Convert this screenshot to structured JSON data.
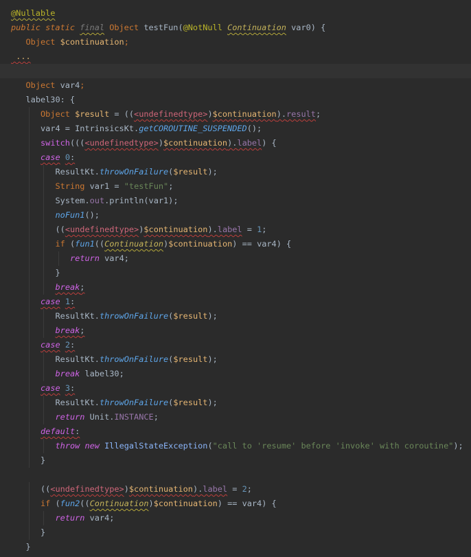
{
  "editor": {
    "lines": [
      {
        "indent": 0,
        "tokens": [
          {
            "t": "@Nullable",
            "c": "anno",
            "u": "ylw"
          }
        ]
      },
      {
        "indent": 0,
        "tokens": [
          {
            "t": "public static ",
            "c": "kwi"
          },
          {
            "t": "final",
            "c": "gray",
            "u": "ylw"
          },
          {
            "t": " Object ",
            "c": "kw"
          },
          {
            "t": "testFun",
            "c": "plain"
          },
          {
            "t": "(",
            "c": "plain"
          },
          {
            "t": "@NotNull",
            "c": "anno"
          },
          {
            "t": " ",
            "c": "plain"
          },
          {
            "t": "Continuation",
            "c": "iface",
            "u": "ylw"
          },
          {
            "t": " var0) {",
            "c": "plain"
          }
        ]
      },
      {
        "indent": 1,
        "tokens": [
          {
            "t": "Object ",
            "c": "kw"
          },
          {
            "t": "$continuation",
            "c": "var"
          },
          {
            "t": ";",
            "c": "kw"
          }
        ]
      },
      {
        "indent": 0,
        "tokens": [
          {
            "t": " ...",
            "c": "red",
            "u": "red"
          }
        ]
      },
      {
        "indent": 0,
        "tokens": [],
        "highlight": true
      },
      {
        "indent": 1,
        "tokens": [
          {
            "t": "Object ",
            "c": "kw"
          },
          {
            "t": "var4",
            "c": "plain"
          },
          {
            "t": ";",
            "c": "kw"
          }
        ]
      },
      {
        "indent": 1,
        "tokens": [
          {
            "t": "label30: {",
            "c": "plain"
          }
        ]
      },
      {
        "indent": 2,
        "tokens": [
          {
            "t": "Object ",
            "c": "kw"
          },
          {
            "t": "$result",
            "c": "var"
          },
          {
            "t": " = ((",
            "c": "plain"
          },
          {
            "t": "<undefinedtype>",
            "c": "undef",
            "u": "red"
          },
          {
            "t": ")",
            "c": "plain"
          },
          {
            "t": "$continuation",
            "c": "var",
            "u": "red"
          },
          {
            "t": ").",
            "c": "plain",
            "u": "red"
          },
          {
            "t": "result",
            "c": "field",
            "u": "red"
          },
          {
            "t": ";",
            "c": "plain"
          }
        ]
      },
      {
        "indent": 2,
        "tokens": [
          {
            "t": "var4 = IntrinsicsKt.",
            "c": "plain"
          },
          {
            "t": "getCOROUTINE_SUSPENDED",
            "c": "method"
          },
          {
            "t": "();",
            "c": "plain"
          }
        ]
      },
      {
        "indent": 2,
        "tokens": [
          {
            "t": "switch",
            "c": "pink"
          },
          {
            "t": "(((",
            "c": "plain"
          },
          {
            "t": "<undefinedtype>",
            "c": "undef",
            "u": "red"
          },
          {
            "t": ")",
            "c": "plain"
          },
          {
            "t": "$continuation",
            "c": "var",
            "u": "red"
          },
          {
            "t": ").",
            "c": "plain",
            "u": "red"
          },
          {
            "t": "label",
            "c": "field",
            "u": "red"
          },
          {
            "t": ") {",
            "c": "plain"
          }
        ]
      },
      {
        "indent": 2,
        "tokens": [
          {
            "t": "case",
            "c": "pkw",
            "u": "red"
          },
          {
            "t": " ",
            "c": "plain"
          },
          {
            "t": "0",
            "c": "num",
            "u": "red"
          },
          {
            "t": ":",
            "c": "plain",
            "u": "red"
          }
        ]
      },
      {
        "indent": 3,
        "tokens": [
          {
            "t": "ResultKt.",
            "c": "plain"
          },
          {
            "t": "throwOnFailure",
            "c": "method"
          },
          {
            "t": "(",
            "c": "plain"
          },
          {
            "t": "$result",
            "c": "var"
          },
          {
            "t": ");",
            "c": "plain"
          }
        ]
      },
      {
        "indent": 3,
        "tokens": [
          {
            "t": "String ",
            "c": "kw"
          },
          {
            "t": "var1",
            "c": "plain"
          },
          {
            "t": " = ",
            "c": "plain"
          },
          {
            "t": "\"testFun\"",
            "c": "string"
          },
          {
            "t": ";",
            "c": "plain"
          }
        ]
      },
      {
        "indent": 3,
        "tokens": [
          {
            "t": "System.",
            "c": "plain"
          },
          {
            "t": "out",
            "c": "field"
          },
          {
            "t": ".println(var1);",
            "c": "plain"
          }
        ]
      },
      {
        "indent": 3,
        "tokens": [
          {
            "t": "noFun1",
            "c": "method"
          },
          {
            "t": "();",
            "c": "plain"
          }
        ]
      },
      {
        "indent": 3,
        "tokens": [
          {
            "t": "((",
            "c": "plain"
          },
          {
            "t": "<undefinedtype>",
            "c": "undef",
            "u": "red"
          },
          {
            "t": ")",
            "c": "plain"
          },
          {
            "t": "$continuation",
            "c": "var",
            "u": "red"
          },
          {
            "t": ").",
            "c": "plain",
            "u": "red"
          },
          {
            "t": "label",
            "c": "field",
            "u": "red"
          },
          {
            "t": " = ",
            "c": "plain"
          },
          {
            "t": "1",
            "c": "num"
          },
          {
            "t": ";",
            "c": "plain"
          }
        ]
      },
      {
        "indent": 3,
        "tokens": [
          {
            "t": "if",
            "c": "kw"
          },
          {
            "t": " (",
            "c": "plain"
          },
          {
            "t": "fun1",
            "c": "method"
          },
          {
            "t": "((",
            "c": "plain"
          },
          {
            "t": "Continuation",
            "c": "iface",
            "u": "ylw"
          },
          {
            "t": ")",
            "c": "plain"
          },
          {
            "t": "$continuation",
            "c": "var"
          },
          {
            "t": ") == var4) {",
            "c": "plain"
          }
        ]
      },
      {
        "indent": 4,
        "tokens": [
          {
            "t": "return",
            "c": "pkw"
          },
          {
            "t": " var4;",
            "c": "plain"
          }
        ]
      },
      {
        "indent": 3,
        "tokens": [
          {
            "t": "}",
            "c": "plain"
          }
        ]
      },
      {
        "indent": 3,
        "tokens": [
          {
            "t": "break",
            "c": "pkw",
            "u": "red"
          },
          {
            "t": ";",
            "c": "plain",
            "u": "red"
          }
        ]
      },
      {
        "indent": 2,
        "tokens": [
          {
            "t": "case",
            "c": "pkw",
            "u": "red"
          },
          {
            "t": " ",
            "c": "plain"
          },
          {
            "t": "1",
            "c": "num",
            "u": "red"
          },
          {
            "t": ":",
            "c": "plain",
            "u": "red"
          }
        ]
      },
      {
        "indent": 3,
        "tokens": [
          {
            "t": "ResultKt.",
            "c": "plain"
          },
          {
            "t": "throwOnFailure",
            "c": "method"
          },
          {
            "t": "(",
            "c": "plain"
          },
          {
            "t": "$result",
            "c": "var"
          },
          {
            "t": ");",
            "c": "plain"
          }
        ]
      },
      {
        "indent": 3,
        "tokens": [
          {
            "t": "break",
            "c": "pkw",
            "u": "red"
          },
          {
            "t": ";",
            "c": "plain",
            "u": "red"
          }
        ]
      },
      {
        "indent": 2,
        "tokens": [
          {
            "t": "case",
            "c": "pkw",
            "u": "red"
          },
          {
            "t": " ",
            "c": "plain"
          },
          {
            "t": "2",
            "c": "num",
            "u": "red"
          },
          {
            "t": ":",
            "c": "plain",
            "u": "red"
          }
        ]
      },
      {
        "indent": 3,
        "tokens": [
          {
            "t": "ResultKt.",
            "c": "plain"
          },
          {
            "t": "throwOnFailure",
            "c": "method"
          },
          {
            "t": "(",
            "c": "plain"
          },
          {
            "t": "$result",
            "c": "var"
          },
          {
            "t": ");",
            "c": "plain"
          }
        ]
      },
      {
        "indent": 3,
        "tokens": [
          {
            "t": "break",
            "c": "pkw"
          },
          {
            "t": " label30;",
            "c": "plain"
          }
        ]
      },
      {
        "indent": 2,
        "tokens": [
          {
            "t": "case",
            "c": "pkw",
            "u": "red"
          },
          {
            "t": " ",
            "c": "plain"
          },
          {
            "t": "3",
            "c": "num",
            "u": "red"
          },
          {
            "t": ":",
            "c": "plain",
            "u": "red"
          }
        ]
      },
      {
        "indent": 3,
        "tokens": [
          {
            "t": "ResultKt.",
            "c": "plain"
          },
          {
            "t": "throwOnFailure",
            "c": "method"
          },
          {
            "t": "(",
            "c": "plain"
          },
          {
            "t": "$result",
            "c": "var"
          },
          {
            "t": ");",
            "c": "plain"
          }
        ]
      },
      {
        "indent": 3,
        "tokens": [
          {
            "t": "return",
            "c": "pkw"
          },
          {
            "t": " Unit.",
            "c": "plain"
          },
          {
            "t": "INSTANCE",
            "c": "field"
          },
          {
            "t": ";",
            "c": "plain"
          }
        ]
      },
      {
        "indent": 2,
        "tokens": [
          {
            "t": "default",
            "c": "pkw",
            "u": "red"
          },
          {
            "t": ":",
            "c": "plain",
            "u": "red"
          }
        ]
      },
      {
        "indent": 3,
        "tokens": [
          {
            "t": "throw new ",
            "c": "pkw"
          },
          {
            "t": "IllegalStateException",
            "c": "class"
          },
          {
            "t": "(",
            "c": "plain"
          },
          {
            "t": "\"call to 'resume' before 'invoke' with coroutine\"",
            "c": "string"
          },
          {
            "t": ");",
            "c": "plain"
          }
        ]
      },
      {
        "indent": 2,
        "tokens": [
          {
            "t": "}",
            "c": "plain"
          }
        ]
      },
      {
        "indent": 0,
        "tokens": []
      },
      {
        "indent": 2,
        "tokens": [
          {
            "t": "((",
            "c": "plain"
          },
          {
            "t": "<undefinedtype>",
            "c": "undef",
            "u": "red"
          },
          {
            "t": ")",
            "c": "plain"
          },
          {
            "t": "$continuation",
            "c": "var",
            "u": "red"
          },
          {
            "t": ").",
            "c": "plain",
            "u": "red"
          },
          {
            "t": "label",
            "c": "field",
            "u": "red"
          },
          {
            "t": " = ",
            "c": "plain"
          },
          {
            "t": "2",
            "c": "num"
          },
          {
            "t": ";",
            "c": "plain"
          }
        ]
      },
      {
        "indent": 2,
        "tokens": [
          {
            "t": "if",
            "c": "kw"
          },
          {
            "t": " (",
            "c": "plain"
          },
          {
            "t": "fun2",
            "c": "method"
          },
          {
            "t": "((",
            "c": "plain"
          },
          {
            "t": "Continuation",
            "c": "iface",
            "u": "ylw"
          },
          {
            "t": ")",
            "c": "plain"
          },
          {
            "t": "$continuation",
            "c": "var"
          },
          {
            "t": ") == var4) {",
            "c": "plain"
          }
        ]
      },
      {
        "indent": 3,
        "tokens": [
          {
            "t": "return",
            "c": "pkw"
          },
          {
            "t": " var4;",
            "c": "plain"
          }
        ]
      },
      {
        "indent": 2,
        "tokens": [
          {
            "t": "}",
            "c": "plain"
          }
        ]
      },
      {
        "indent": 1,
        "tokens": [
          {
            "t": "}",
            "c": "plain"
          }
        ]
      }
    ]
  }
}
